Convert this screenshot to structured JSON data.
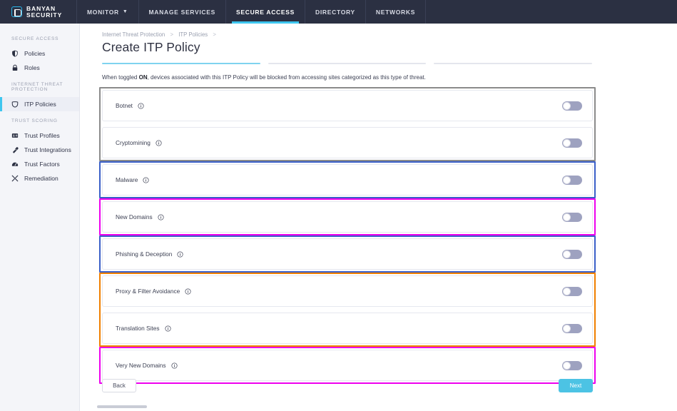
{
  "brand": {
    "line1": "BANYAN",
    "line2": "SECURITY",
    "logo_icon": "banyan-shield-icon",
    "accent": "#27b4e8"
  },
  "topnav": {
    "monitor": {
      "label": "MONITOR",
      "caret_icon": "chevron-down-icon"
    },
    "items": [
      {
        "label": "MANAGE SERVICES",
        "active": false
      },
      {
        "label": "SECURE ACCESS",
        "active": true
      },
      {
        "label": "DIRECTORY",
        "active": false
      },
      {
        "label": "NETWORKS",
        "active": false
      }
    ],
    "active_underline_color": "#3ec6ef",
    "background": "#2b3042"
  },
  "sidebar": {
    "groups": [
      {
        "heading": "SECURE ACCESS",
        "items": [
          {
            "label": "Policies",
            "icon": "shield-icon",
            "selected": false
          },
          {
            "label": "Roles",
            "icon": "lock-icon",
            "selected": false
          }
        ]
      },
      {
        "heading": "INTERNET THREAT PROTECTION",
        "items": [
          {
            "label": "ITP Policies",
            "icon": "threat-shield-icon",
            "selected": true
          }
        ]
      },
      {
        "heading": "TRUST SCORING",
        "items": [
          {
            "label": "Trust Profiles",
            "icon": "id-card-icon",
            "selected": false
          },
          {
            "label": "Trust Integrations",
            "icon": "plug-icon",
            "selected": false
          },
          {
            "label": "Trust Factors",
            "icon": "gauge-icon",
            "selected": false
          },
          {
            "label": "Remediation",
            "icon": "tools-icon",
            "selected": false
          }
        ]
      }
    ]
  },
  "main": {
    "breadcrumb": {
      "items": [
        "Internet Threat Protection",
        "ITP Policies"
      ],
      "separator": ">",
      "trailing_separator": ">"
    },
    "title": "Create ITP Policy",
    "stepper": {
      "total": 3,
      "current": 1,
      "active_color": "#7fd3ef",
      "inactive_color": "#e4e6ed"
    },
    "description": {
      "prefix": "When toggled ",
      "bold": "ON",
      "suffix": ", devices associated with this ITP Policy will be blocked from accessing sites categorized as this type of threat."
    },
    "threat_rows": [
      {
        "label": "Botnet",
        "info_icon": "info-icon",
        "toggle": "off"
      },
      {
        "label": "Cryptomining",
        "info_icon": "info-icon",
        "toggle": "off"
      },
      {
        "label": "Malware",
        "info_icon": "info-icon",
        "toggle": "off"
      },
      {
        "label": "New Domains",
        "info_icon": "info-icon",
        "toggle": "off"
      },
      {
        "label": "Phishing & Deception",
        "info_icon": "info-icon",
        "toggle": "off"
      },
      {
        "label": "Proxy & Filter Avoidance",
        "info_icon": "info-icon",
        "toggle": "off"
      },
      {
        "label": "Translation Sites",
        "info_icon": "info-icon",
        "toggle": "off"
      },
      {
        "label": "Very New Domains",
        "info_icon": "info-icon",
        "toggle": "off"
      }
    ],
    "annotations": [
      {
        "name": "group-botnet-cryptomining",
        "color": "#8b8b8b",
        "rows": [
          0,
          1
        ]
      },
      {
        "name": "group-malware",
        "color": "#3a5fc8",
        "rows": [
          2,
          2
        ]
      },
      {
        "name": "group-new-domains",
        "color": "#ee00ee",
        "rows": [
          3,
          3
        ]
      },
      {
        "name": "group-phishing-deception",
        "color": "#3a5fc8",
        "rows": [
          4,
          4
        ]
      },
      {
        "name": "group-proxy-translation",
        "color": "#f08000",
        "rows": [
          5,
          6
        ]
      },
      {
        "name": "group-very-new-domains",
        "color": "#ee00ee",
        "rows": [
          7,
          7
        ]
      }
    ],
    "footer": {
      "back_label": "Back",
      "next_label": "Next",
      "next_color": "#4cc3e4"
    }
  }
}
